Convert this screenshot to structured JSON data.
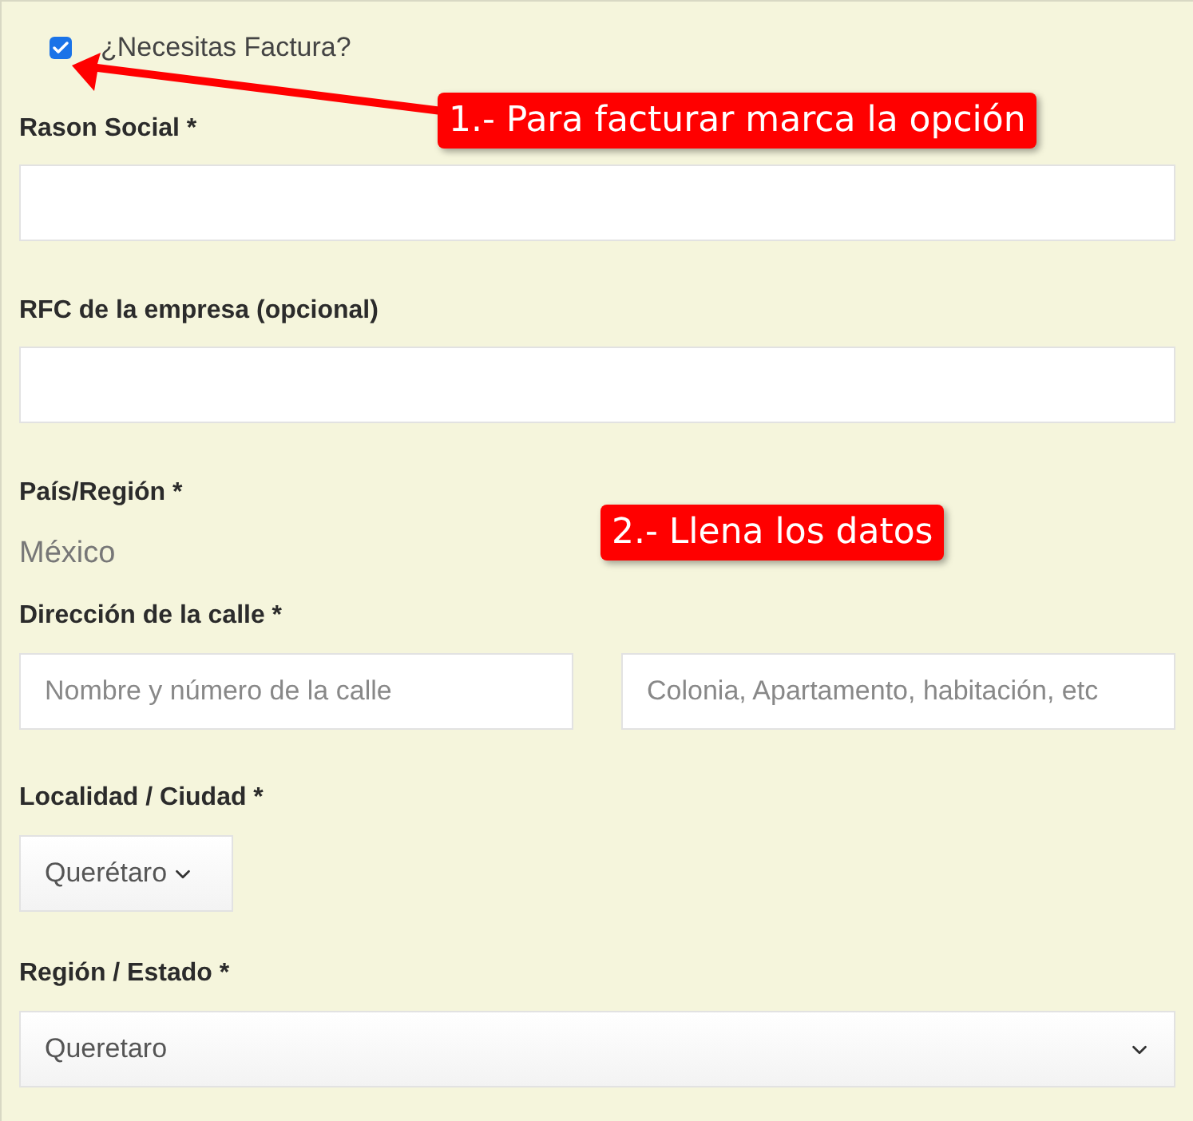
{
  "invoice_checkbox": {
    "label": "¿Necesitas Factura?",
    "checked": true
  },
  "fields": [
    {
      "kind": "text",
      "label": "Rason Social *"
    },
    {
      "kind": "text",
      "label": "RFC de la empresa (opcional)"
    },
    {
      "kind": "static",
      "label": "País/Región *",
      "value": "México"
    },
    {
      "kind": "pair",
      "label": "Dirección de la calle *",
      "placeholders": [
        "Nombre y número de la calle",
        "Colonia, Apartamento, habitación, etc"
      ]
    },
    {
      "kind": "select_small",
      "label": "Localidad / Ciudad *",
      "value": "Querétaro"
    },
    {
      "kind": "select_full",
      "label": "Región / Estado *",
      "value": "Queretaro"
    }
  ],
  "annotations": [
    {
      "text": "1.- Para facturar marca la opción"
    },
    {
      "text": "2.- Llena los datos"
    }
  ]
}
